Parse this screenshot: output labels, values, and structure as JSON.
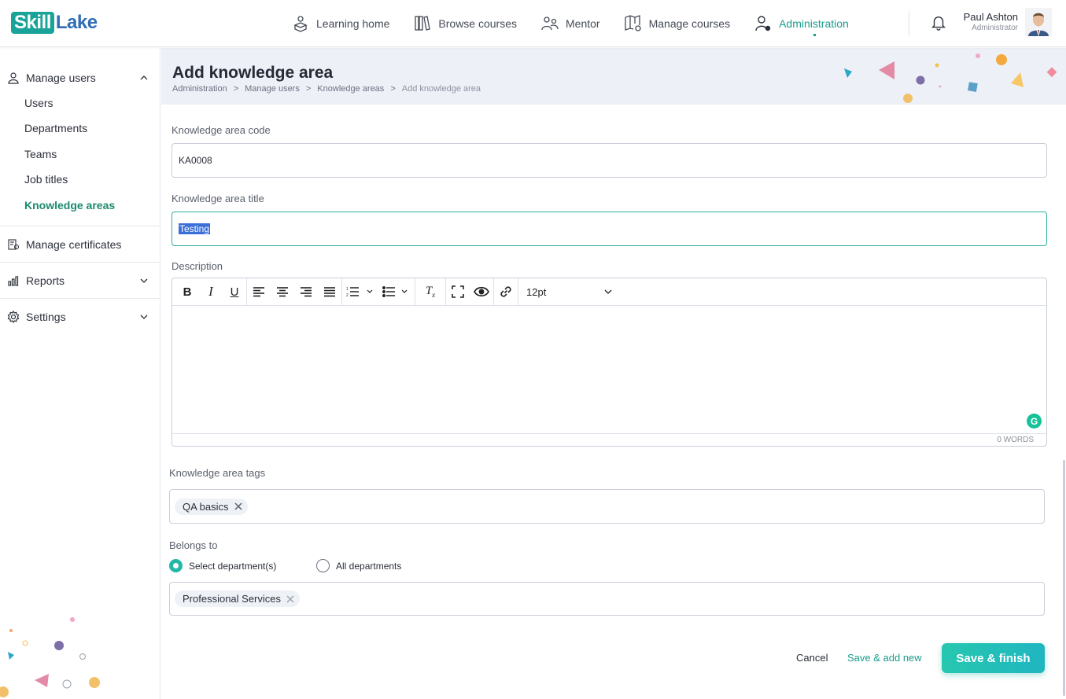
{
  "brand": {
    "part1": "Skill",
    "part2": "Lake"
  },
  "nav": [
    {
      "label": "Learning home",
      "icon": "learning-home-icon"
    },
    {
      "label": "Browse courses",
      "icon": "books-icon"
    },
    {
      "label": "Mentor",
      "icon": "mentor-icon"
    },
    {
      "label": "Manage courses",
      "icon": "manage-courses-icon"
    },
    {
      "label": "Administration",
      "icon": "admin-icon",
      "active": true
    }
  ],
  "user": {
    "name": "Paul Ashton",
    "role": "Administrator"
  },
  "sidebar": {
    "manage_users": "Manage users",
    "sub": [
      "Users",
      "Departments",
      "Teams",
      "Job titles",
      "Knowledge areas"
    ],
    "manage_certificates": "Manage certificates",
    "reports": "Reports",
    "settings": "Settings"
  },
  "page": {
    "title": "Add knowledge area",
    "breadcrumb": [
      "Administration",
      "Manage users",
      "Knowledge areas",
      "Add knowledge area"
    ]
  },
  "form": {
    "code_label": "Knowledge area code",
    "code_value": "KA0008",
    "title_label": "Knowledge area title",
    "title_value": "Testing",
    "description_label": "Description",
    "font_size": "12pt",
    "word_count": "0 WORDS",
    "tags_label": "Knowledge area tags",
    "tags": [
      "QA basics"
    ],
    "belongs_label": "Belongs to",
    "radio_select": "Select department(s)",
    "radio_all": "All departments",
    "departments": [
      "Professional Services"
    ]
  },
  "actions": {
    "cancel": "Cancel",
    "save_add": "Save & add new",
    "save_finish": "Save & finish"
  },
  "colors": {
    "accent": "#1a9d8b",
    "primary_button": "#27c7b0",
    "brand_blue": "#2f6db5"
  }
}
